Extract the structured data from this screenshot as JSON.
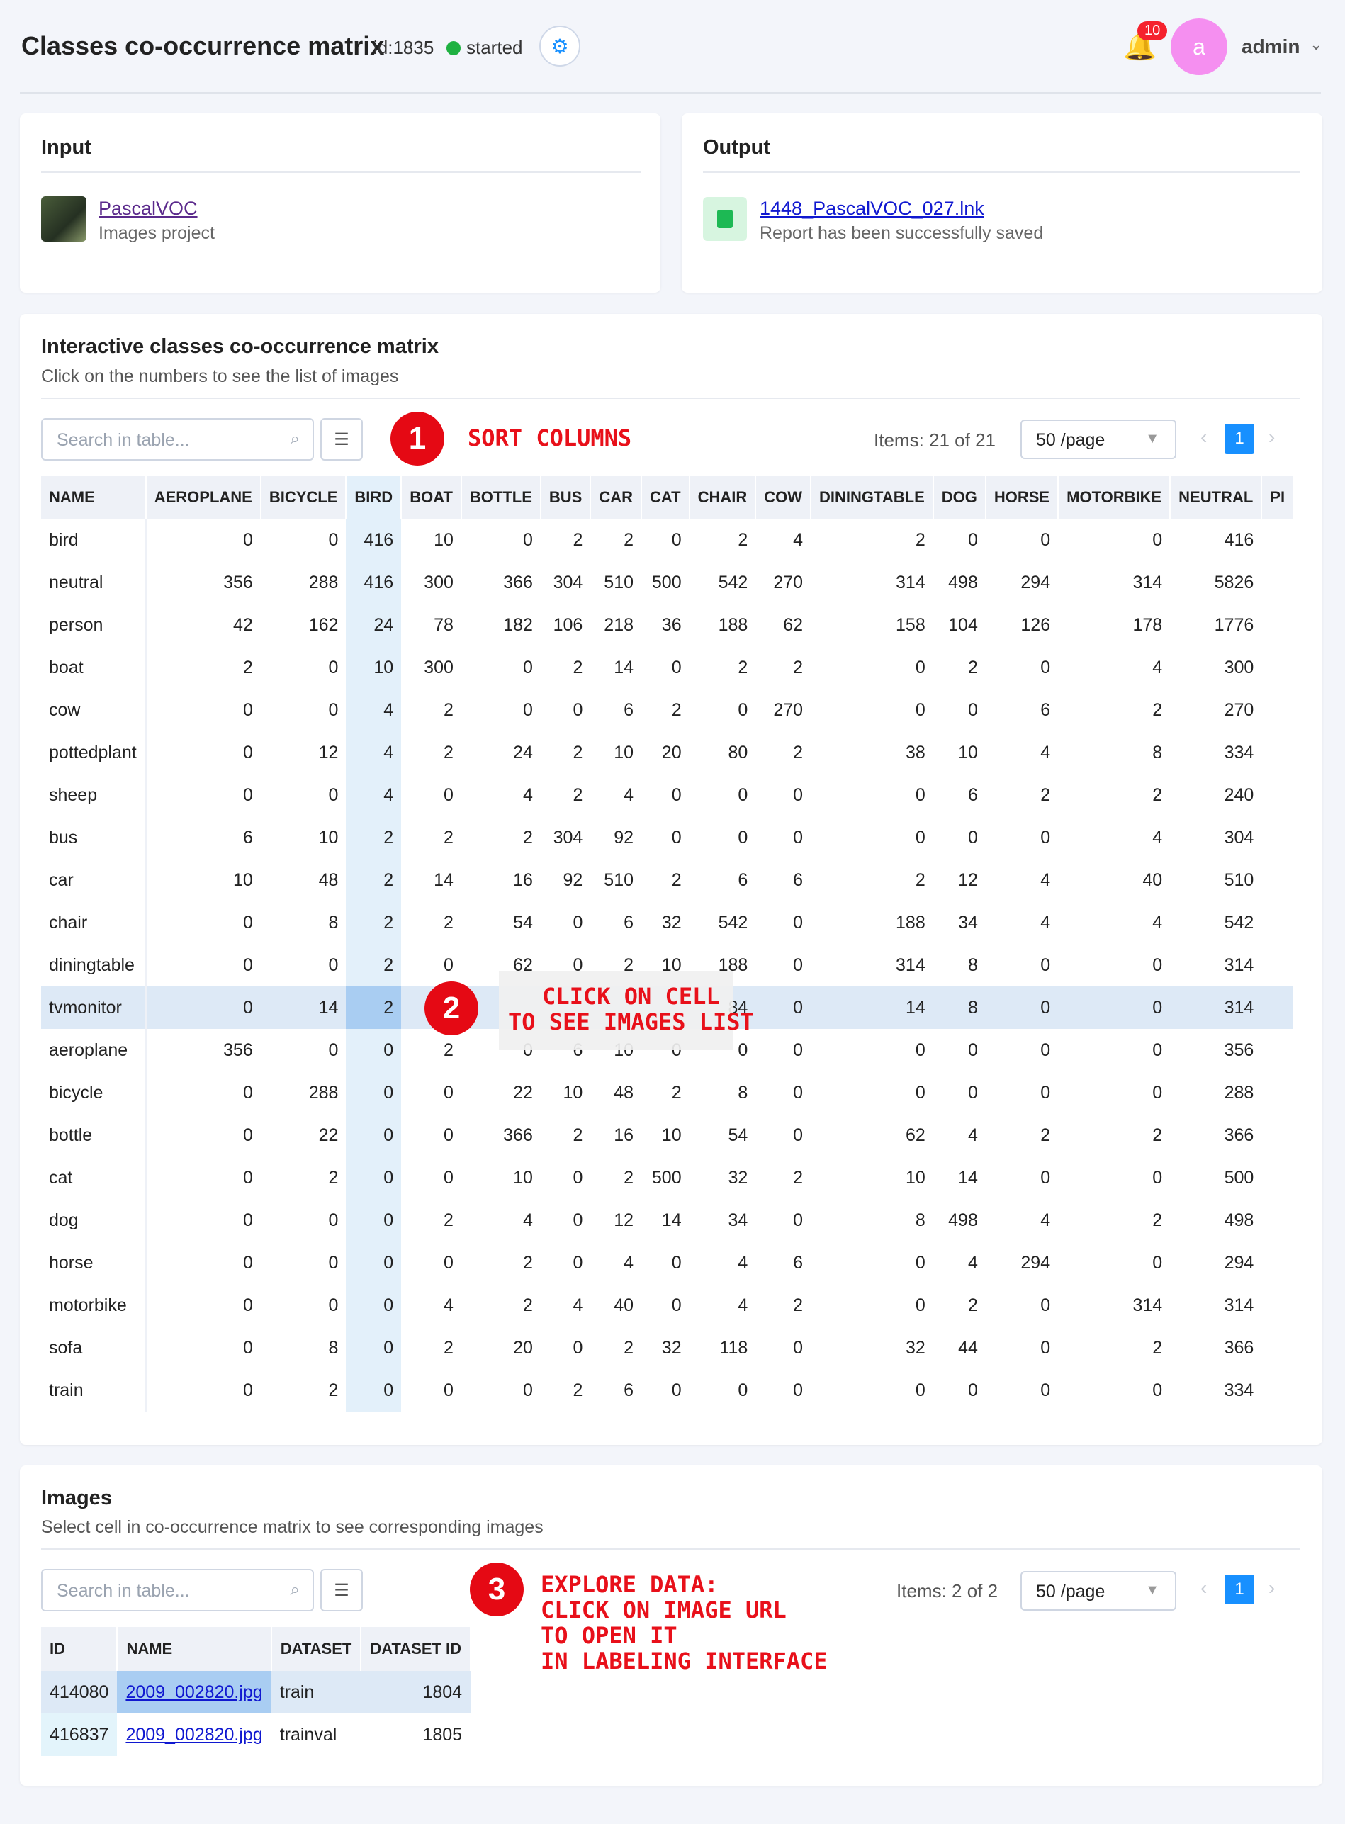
{
  "header": {
    "title": "Classes co-occurrence matrix",
    "task_id": "id:1835",
    "status": "started",
    "notifications": "10",
    "avatar_letter": "a",
    "username": "admin"
  },
  "input_card": {
    "title": "Input",
    "project_name": "PascalVOC",
    "project_type": "Images project"
  },
  "output_card": {
    "title": "Output",
    "file_name": "1448_PascalVOC_027.lnk",
    "message": "Report has been successfully saved"
  },
  "matrix_card": {
    "title": "Interactive classes co-occurrence matrix",
    "subtitle": "Click on the numbers to see the list of images",
    "search_placeholder": "Search in table...",
    "items": "Items: 21 of 21",
    "page_size": "50 /page",
    "page": "1",
    "columns": [
      "NAME",
      "AEROPLANE",
      "BICYCLE",
      "BIRD",
      "BOAT",
      "BOTTLE",
      "BUS",
      "CAR",
      "CAT",
      "CHAIR",
      "COW",
      "DININGTABLE",
      "DOG",
      "HORSE",
      "MOTORBIKE",
      "NEUTRAL",
      "PI"
    ],
    "rows": [
      [
        "bird",
        "0",
        "0",
        "416",
        "10",
        "0",
        "2",
        "2",
        "0",
        "2",
        "4",
        "2",
        "0",
        "0",
        "0",
        "416",
        ""
      ],
      [
        "neutral",
        "356",
        "288",
        "416",
        "300",
        "366",
        "304",
        "510",
        "500",
        "542",
        "270",
        "314",
        "498",
        "294",
        "314",
        "5826",
        ""
      ],
      [
        "person",
        "42",
        "162",
        "24",
        "78",
        "182",
        "106",
        "218",
        "36",
        "188",
        "62",
        "158",
        "104",
        "126",
        "178",
        "1776",
        ""
      ],
      [
        "boat",
        "2",
        "0",
        "10",
        "300",
        "0",
        "2",
        "14",
        "0",
        "2",
        "2",
        "0",
        "2",
        "0",
        "4",
        "300",
        ""
      ],
      [
        "cow",
        "0",
        "0",
        "4",
        "2",
        "0",
        "0",
        "6",
        "2",
        "0",
        "270",
        "0",
        "0",
        "6",
        "2",
        "270",
        ""
      ],
      [
        "pottedplant",
        "0",
        "12",
        "4",
        "2",
        "24",
        "2",
        "10",
        "20",
        "80",
        "2",
        "38",
        "10",
        "4",
        "8",
        "334",
        ""
      ],
      [
        "sheep",
        "0",
        "0",
        "4",
        "0",
        "4",
        "2",
        "4",
        "0",
        "0",
        "0",
        "0",
        "6",
        "2",
        "2",
        "240",
        ""
      ],
      [
        "bus",
        "6",
        "10",
        "2",
        "2",
        "2",
        "304",
        "92",
        "0",
        "0",
        "0",
        "0",
        "0",
        "0",
        "4",
        "304",
        ""
      ],
      [
        "car",
        "10",
        "48",
        "2",
        "14",
        "16",
        "92",
        "510",
        "2",
        "6",
        "6",
        "2",
        "12",
        "4",
        "40",
        "510",
        ""
      ],
      [
        "chair",
        "0",
        "8",
        "2",
        "2",
        "54",
        "0",
        "6",
        "32",
        "542",
        "0",
        "188",
        "34",
        "4",
        "4",
        "542",
        ""
      ],
      [
        "diningtable",
        "0",
        "0",
        "2",
        "0",
        "62",
        "0",
        "2",
        "10",
        "188",
        "0",
        "314",
        "8",
        "0",
        "0",
        "314",
        ""
      ],
      [
        "tvmonitor",
        "0",
        "14",
        "2",
        "",
        "",
        "",
        "",
        "",
        "84",
        "0",
        "14",
        "8",
        "0",
        "0",
        "314",
        ""
      ],
      [
        "aeroplane",
        "356",
        "0",
        "0",
        "2",
        "0",
        "6",
        "10",
        "0",
        "0",
        "0",
        "0",
        "0",
        "0",
        "0",
        "356",
        ""
      ],
      [
        "bicycle",
        "0",
        "288",
        "0",
        "0",
        "22",
        "10",
        "48",
        "2",
        "8",
        "0",
        "0",
        "0",
        "0",
        "0",
        "288",
        ""
      ],
      [
        "bottle",
        "0",
        "22",
        "0",
        "0",
        "366",
        "2",
        "16",
        "10",
        "54",
        "0",
        "62",
        "4",
        "2",
        "2",
        "366",
        ""
      ],
      [
        "cat",
        "0",
        "2",
        "0",
        "0",
        "10",
        "0",
        "2",
        "500",
        "32",
        "2",
        "10",
        "14",
        "0",
        "0",
        "500",
        ""
      ],
      [
        "dog",
        "0",
        "0",
        "0",
        "2",
        "4",
        "0",
        "12",
        "14",
        "34",
        "0",
        "8",
        "498",
        "4",
        "2",
        "498",
        ""
      ],
      [
        "horse",
        "0",
        "0",
        "0",
        "0",
        "2",
        "0",
        "4",
        "0",
        "4",
        "6",
        "0",
        "4",
        "294",
        "0",
        "294",
        ""
      ],
      [
        "motorbike",
        "0",
        "0",
        "0",
        "4",
        "2",
        "4",
        "40",
        "0",
        "4",
        "2",
        "0",
        "2",
        "0",
        "314",
        "314",
        ""
      ],
      [
        "sofa",
        "0",
        "8",
        "0",
        "2",
        "20",
        "0",
        "2",
        "32",
        "118",
        "0",
        "32",
        "44",
        "0",
        "2",
        "366",
        ""
      ],
      [
        "train",
        "0",
        "2",
        "0",
        "0",
        "0",
        "2",
        "6",
        "0",
        "0",
        "0",
        "0",
        "0",
        "0",
        "0",
        "334",
        ""
      ]
    ]
  },
  "images_card": {
    "title": "Images",
    "subtitle": "Select cell in co-occurrence matrix to see corresponding images",
    "search_placeholder": "Search in table...",
    "items": "Items: 2 of 2",
    "page_size": "50 /page",
    "page": "1",
    "columns": [
      "ID",
      "NAME",
      "DATASET",
      "DATASET ID"
    ],
    "rows": [
      [
        "414080",
        "2009_002820.jpg",
        "train",
        "1804"
      ],
      [
        "416837",
        "2009_002820.jpg",
        "trainval",
        "1805"
      ]
    ]
  },
  "annotations": {
    "one": {
      "num": "1",
      "text": "SORT COLUMNS"
    },
    "two": {
      "num": "2",
      "text": "CLICK ON CELL\nTO SEE IMAGES LIST"
    },
    "three": {
      "num": "3",
      "text": "EXPLORE DATA:\nCLICK ON IMAGE URL\nTO OPEN IT\nIN LABELING INTERFACE"
    }
  },
  "colors": {
    "accent": "#1890ff",
    "status_green": "#1fb141",
    "annotation_red": "#e50914",
    "avatar": "#f58ff0"
  },
  "icons": [
    "gear-icon",
    "bell-icon",
    "chevron-down-icon",
    "search-icon",
    "filter-icon",
    "chevron-left-icon",
    "chevron-right-icon",
    "file-icon"
  ]
}
